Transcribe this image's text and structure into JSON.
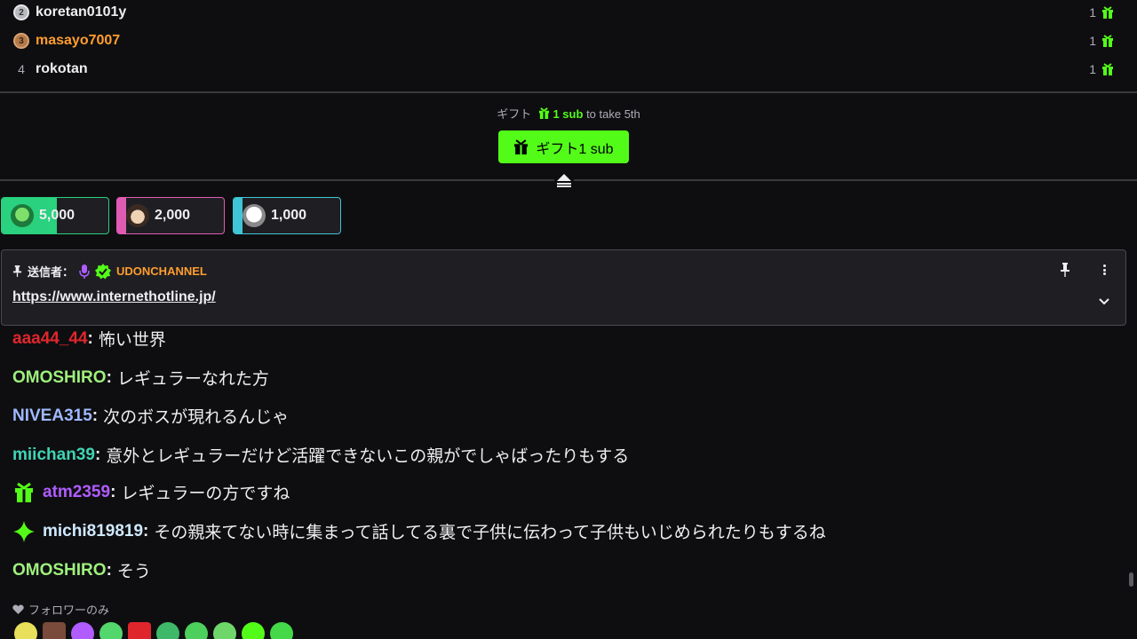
{
  "leaderboard": [
    {
      "rank": "2",
      "name": "koretan0101y",
      "count": "1",
      "name_color": "#efeff1"
    },
    {
      "rank": "3",
      "name": "masayo7007",
      "count": "1",
      "name_color": "#ff9d2e"
    },
    {
      "rank": "4",
      "name": "rokotan",
      "count": "1",
      "name_color": "#efeff1"
    }
  ],
  "gift_hint": {
    "prefix": "ギフト",
    "highlight": "1 sub",
    "suffix": "to take 5th"
  },
  "gift_button": {
    "label": "ギフト1 sub"
  },
  "rewards": [
    {
      "amount": "5,000",
      "accent": "#2ad17e",
      "progress": 0.52
    },
    {
      "amount": "2,000",
      "accent": "#e05cb3",
      "progress": 0.08
    },
    {
      "amount": "1,000",
      "accent": "#3fc6d6",
      "progress": 0.08
    }
  ],
  "pinned": {
    "sender_label": "送信者：",
    "sender_name": "UDONCHANNEL",
    "url": "https://www.internethotline.jp/"
  },
  "chat": [
    {
      "user": "aaa44_44",
      "color": "#e0262d",
      "text": "怖い世界",
      "badge": ""
    },
    {
      "user": "OMOSHIRO",
      "color": "#9ef07d",
      "text": "レギュラーなれた方",
      "badge": ""
    },
    {
      "user": "NIVEA315",
      "color": "#9fb8ff",
      "text": "次のボスが現れるんじゃ",
      "badge": ""
    },
    {
      "user": "miichan39",
      "color": "#3fd4b5",
      "text": "意外とレギュラーだけど活躍できないこの親がでしゃばったりもする",
      "badge": ""
    },
    {
      "user": "atm2359",
      "color": "#b05cff",
      "text": "レギュラーの方ですね",
      "badge": "gift-badge"
    },
    {
      "user": "michi819819",
      "color": "#cfe9ff",
      "text": "その親来てない時に集まって話してる裏で子供に伝わって子供もいじめられたりもするね",
      "badge": "sparkle-badge"
    },
    {
      "user": "OMOSHIRO",
      "color": "#9ef07d",
      "text": "そう",
      "badge": ""
    }
  ],
  "follower_only": {
    "label": "フォロワーのみ"
  },
  "colors": {
    "accent": "#53fc18",
    "background": "#0e0e10",
    "panel": "#1f1f23"
  }
}
